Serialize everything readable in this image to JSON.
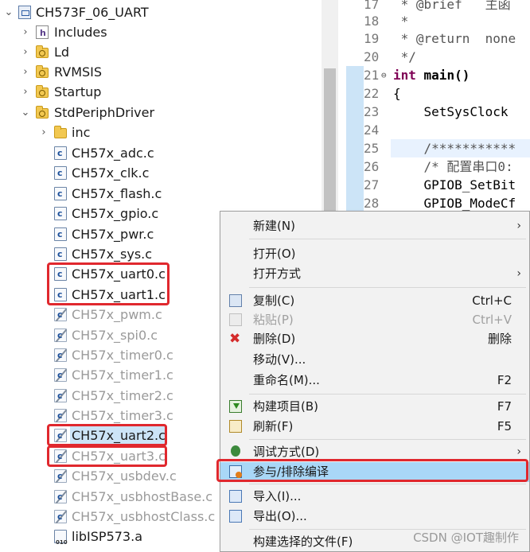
{
  "project": {
    "name": "CH573F_06_UART",
    "items": [
      {
        "label": "Includes"
      },
      {
        "label": "Ld"
      },
      {
        "label": "RVMSIS"
      },
      {
        "label": "Startup"
      },
      {
        "label": "StdPeriphDriver"
      },
      {
        "label": "inc"
      }
    ],
    "files": [
      {
        "label": "CH57x_adc.c"
      },
      {
        "label": "CH57x_clk.c"
      },
      {
        "label": "CH57x_flash.c"
      },
      {
        "label": "CH57x_gpio.c"
      },
      {
        "label": "CH57x_pwr.c"
      },
      {
        "label": "CH57x_sys.c"
      },
      {
        "label": "CH57x_uart0.c"
      },
      {
        "label": "CH57x_uart1.c"
      },
      {
        "label": "CH57x_pwm.c"
      },
      {
        "label": "CH57x_spi0.c"
      },
      {
        "label": "CH57x_timer0.c"
      },
      {
        "label": "CH57x_timer1.c"
      },
      {
        "label": "CH57x_timer2.c"
      },
      {
        "label": "CH57x_timer3.c"
      },
      {
        "label": "CH57x_uart2.c"
      },
      {
        "label": "CH57x_uart3.c"
      },
      {
        "label": "CH57x_usbdev.c"
      },
      {
        "label": "CH57x_usbhostBase.c"
      },
      {
        "label": "CH57x_usbhostClass.c"
      },
      {
        "label": "libISP573.a"
      }
    ]
  },
  "editor": {
    "lines": [
      {
        "num": "17",
        "code": " * @brief   主函"
      },
      {
        "num": "18",
        "code": " *"
      },
      {
        "num": "19",
        "code": " * @return  none"
      },
      {
        "num": "20",
        "code": " */"
      },
      {
        "num": "21",
        "code_kw": "int",
        "code_rest": " main()"
      },
      {
        "num": "22",
        "code": "{"
      },
      {
        "num": "23",
        "code": "    SetSysClock"
      },
      {
        "num": "24",
        "code": ""
      },
      {
        "num": "25",
        "code": "    /***********"
      },
      {
        "num": "26",
        "code": "    /* 配置串口0:"
      },
      {
        "num": "27",
        "code": "    GPIOB_SetBit"
      },
      {
        "num": "28",
        "code": "    GPIOB_ModeCf"
      }
    ]
  },
  "context_menu": {
    "items": [
      {
        "label": "新建(N)",
        "submenu": "›"
      },
      {
        "label": "打开(O)"
      },
      {
        "label": "打开方式",
        "submenu": "›"
      },
      {
        "label": "复制(C)",
        "shortcut": "Ctrl+C",
        "icon": "copy-icon"
      },
      {
        "label": "粘贴(P)",
        "shortcut": "Ctrl+V",
        "icon": "paste-icon"
      },
      {
        "label": "删除(D)",
        "shortcut": "删除",
        "icon": "delete-icon",
        "icon_glyph": "✖"
      },
      {
        "label": "移动(V)..."
      },
      {
        "label": "重命名(M)...",
        "shortcut": "F2"
      },
      {
        "label": "构建项目(B)",
        "shortcut": "F7",
        "icon": "build-icon"
      },
      {
        "label": "刷新(F)",
        "shortcut": "F5",
        "icon": "refresh-icon"
      },
      {
        "label": "调试方式(D)",
        "submenu": "›",
        "icon": "debug-icon"
      },
      {
        "label": "参与/排除编译",
        "icon": "exclude-from-build-icon"
      },
      {
        "label": "导入(I)...",
        "icon": "import-icon"
      },
      {
        "label": "导出(O)...",
        "icon": "export-icon"
      },
      {
        "label": "构建选择的文件(F)"
      }
    ]
  },
  "tree_arrows": {
    "collapsed": "›",
    "expanded": "⌄"
  },
  "colors": {
    "highlight_red": "#e0282e",
    "menu_hover": "#a9d7f7",
    "selection": "#cce4f7"
  },
  "watermark": "CSDN @IOT趣制作"
}
